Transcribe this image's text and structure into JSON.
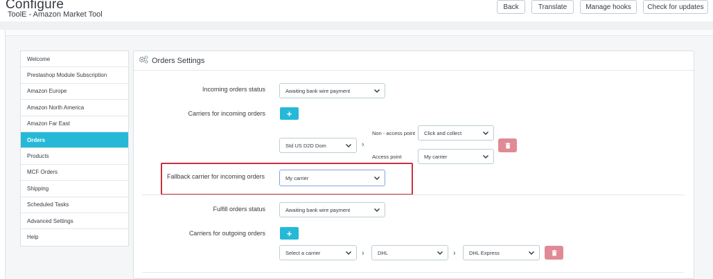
{
  "header": {
    "title": "Configure",
    "subtitle": "ToolE - Amazon Market Tool",
    "buttons": {
      "back": "Back",
      "translate": "Translate",
      "manage_hooks": "Manage hooks",
      "check_updates": "Check for updates"
    }
  },
  "sidebar": {
    "items": [
      {
        "label": "Welcome"
      },
      {
        "label": "Prestashop Module Subscription"
      },
      {
        "label": "Amazon Europe"
      },
      {
        "label": "Amazon North America"
      },
      {
        "label": "Amazon Far East"
      },
      {
        "label": "Orders"
      },
      {
        "label": "Products"
      },
      {
        "label": "MCF Orders"
      },
      {
        "label": "Shipping"
      },
      {
        "label": "Scheduled Tasks"
      },
      {
        "label": "Advanced Settings"
      },
      {
        "label": "Help"
      }
    ],
    "active": "Orders"
  },
  "panel": {
    "title": "Orders Settings",
    "incoming_status_label": "Incoming orders status",
    "incoming_status_value": "Awaiting bank wire payment",
    "carriers_incoming_label": "Carriers for incoming orders",
    "incoming_carrier_value": "Std US D2D Dom",
    "non_access_point_label": "Non - access point",
    "non_access_point_value": "Click and collect",
    "access_point_label": "Access point",
    "access_point_value": "My carrier",
    "fallback_label": "Fallback carrier for incoming orders",
    "fallback_value": "My carrier",
    "fulfill_status_label": "Fulfill orders status",
    "fulfill_status_value": "Awaiting bank wire payment",
    "carriers_outgoing_label": "Carriers for outgoing orders",
    "outgoing_carrier_value": "Select a carrier",
    "outgoing_carrier2_value": "DHL",
    "outgoing_service_value": "DHL Express",
    "plus_symbol": "+",
    "arrow_symbol": "›"
  },
  "colors": {
    "accent": "#25b9d7",
    "delete": "#e08a95",
    "highlight": "#c9303a"
  }
}
